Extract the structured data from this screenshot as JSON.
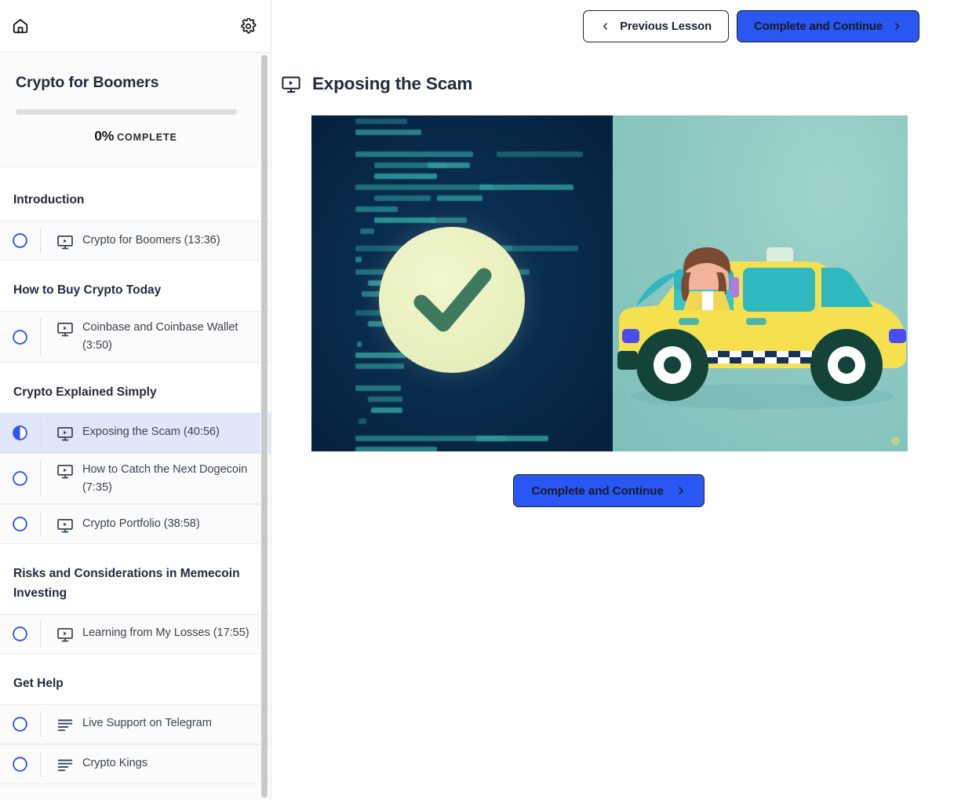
{
  "sidebar": {
    "home_icon": "home-icon",
    "settings_icon": "gear-icon",
    "course": {
      "title": "Crypto for Boomers",
      "progress_percent": 0,
      "progress_value_label": "0%",
      "progress_word": "COMPLETE"
    },
    "sections": [
      {
        "title": "Introduction",
        "lessons": [
          {
            "label": "Crypto for Boomers (13:36)",
            "type_icon": "video-icon",
            "status": "not-started",
            "status_icon": "circle-outline-icon",
            "active": false
          }
        ]
      },
      {
        "title": "How to Buy Crypto Today",
        "lessons": [
          {
            "label": "Coinbase and Coinbase Wallet (3:50)",
            "type_icon": "video-icon",
            "status": "not-started",
            "status_icon": "circle-outline-icon",
            "active": false
          }
        ]
      },
      {
        "title": "Crypto Explained Simply",
        "lessons": [
          {
            "label": "Exposing the Scam (40:56)",
            "type_icon": "video-icon",
            "status": "in-progress",
            "status_icon": "circle-half-filled-icon",
            "active": true
          },
          {
            "label": "How to Catch the Next Dogecoin (7:35)",
            "type_icon": "video-icon",
            "status": "not-started",
            "status_icon": "circle-outline-icon",
            "active": false
          },
          {
            "label": "Crypto Portfolio (38:58)",
            "type_icon": "video-icon",
            "status": "not-started",
            "status_icon": "circle-outline-icon",
            "active": false
          }
        ]
      },
      {
        "title": "Risks and Considerations in Memecoin Investing",
        "lessons": [
          {
            "label": "Learning from My Losses (17:55)",
            "type_icon": "video-icon",
            "status": "not-started",
            "status_icon": "circle-outline-icon",
            "active": false
          }
        ]
      },
      {
        "title": "Get Help",
        "lessons": [
          {
            "label": "Live Support on Telegram",
            "type_icon": "text-lines-icon",
            "status": "not-started",
            "status_icon": "circle-outline-icon",
            "active": false
          },
          {
            "label": "Crypto Kings",
            "type_icon": "text-lines-icon",
            "status": "not-started",
            "status_icon": "circle-outline-icon",
            "active": false
          }
        ]
      }
    ]
  },
  "main": {
    "toolbar": {
      "previous_label": "Previous Lesson",
      "previous_icon": "chevron-left-icon",
      "complete_label": "Complete and Continue",
      "complete_icon": "chevron-right-icon"
    },
    "lesson": {
      "title": "Exposing the Scam",
      "title_icon": "video-icon"
    },
    "video": {
      "alt": "Split illustration: blue code screen with green check badge on the left, yellow taxi with driver on a teal background on the right",
      "watermark_icon": "watermark-icon"
    },
    "footer_cta": {
      "label": "Complete and Continue",
      "icon": "chevron-right-icon"
    }
  },
  "colors": {
    "accent_blue": "#2a56f2",
    "status_ring": "#2f55f5",
    "active_row_bg": "#e2e6fb",
    "text_dark": "#252a3d",
    "sidebar_bg": "#fbfbfb",
    "video_navy": "#07264c",
    "video_teal": "#8ec9c2",
    "taxi_yellow": "#f5e14f",
    "check_green": "#3f7a5e"
  }
}
